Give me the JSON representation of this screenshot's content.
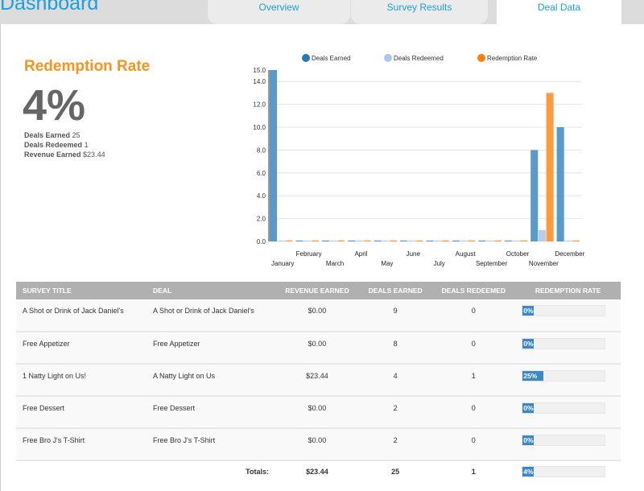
{
  "header": {
    "title": "Dashboard",
    "tabs": [
      {
        "label": "Overview"
      },
      {
        "label": "Survey Results"
      },
      {
        "label": "Deal Data",
        "active": true
      }
    ]
  },
  "summary": {
    "label": "Redemption Rate",
    "value": "4%",
    "deals_earned_label": "Deals Earned",
    "deals_earned": "25",
    "deals_redeemed_label": "Deals Redeemed",
    "deals_redeemed": "1",
    "revenue_label": "Revenue Earned",
    "revenue": "$23.44"
  },
  "colors": {
    "accent": "#1aa0dc",
    "orange": "#f7931e",
    "deals_earned": "#5a9ac9",
    "deals_redeemed": "#b9cde8",
    "redemption_rate": "#ff9a40"
  },
  "chart_data": {
    "type": "bar",
    "categories": [
      "January",
      "February",
      "March",
      "April",
      "May",
      "June",
      "July",
      "August",
      "September",
      "October",
      "November",
      "December"
    ],
    "series": [
      {
        "name": "Deals Earned",
        "values": [
          15,
          0,
          0,
          0,
          0,
          0,
          0,
          0,
          0,
          0,
          8,
          10
        ]
      },
      {
        "name": "Deals Redeemed",
        "values": [
          0,
          0,
          0,
          0,
          0,
          0,
          0,
          0,
          0,
          0,
          1,
          0
        ]
      },
      {
        "name": "Redemption Rate",
        "values": [
          0,
          0,
          0,
          0,
          0,
          0,
          0,
          0,
          0,
          0,
          13,
          0
        ]
      }
    ],
    "yticks": [
      "0.0",
      "2.0",
      "4.0",
      "6.0",
      "8.0",
      "10.0",
      "12.0",
      "14.0",
      "15.0"
    ],
    "ylim": [
      0,
      15
    ],
    "grid": true,
    "legend": "top"
  },
  "table": {
    "headers": [
      "SURVEY TITLE",
      "DEAL",
      "REVENUE EARNED",
      "DEALS EARNED",
      "DEALS REDEEMED",
      "REDEMPTION RATE"
    ],
    "rows": [
      {
        "survey": "A Shot or Drink of Jack Daniel's",
        "deal": "A Shot or Drink of Jack Daniel's",
        "revenue": "$0.00",
        "earned": "9",
        "redeemed": "0",
        "rate": "0%",
        "rate_value": 0
      },
      {
        "survey": "Free Appetizer",
        "deal": "Free Appetizer",
        "revenue": "$0.00",
        "earned": "8",
        "redeemed": "0",
        "rate": "0%",
        "rate_value": 0
      },
      {
        "survey": "1 Natty Light on Us!",
        "deal": "A Natty Light on Us",
        "revenue": "$23.44",
        "earned": "4",
        "redeemed": "1",
        "rate": "25%",
        "rate_value": 25
      },
      {
        "survey": "Free Dessert",
        "deal": "Free Dessert",
        "revenue": "$0.00",
        "earned": "2",
        "redeemed": "0",
        "rate": "0%",
        "rate_value": 0
      },
      {
        "survey": "Free Bro J's T-Shirt",
        "deal": "Free Bro J's T-Shirt",
        "revenue": "$0.00",
        "earned": "2",
        "redeemed": "0",
        "rate": "0%",
        "rate_value": 0
      }
    ],
    "totals": {
      "label": "Totals:",
      "revenue": "$23.44",
      "earned": "25",
      "redeemed": "1",
      "rate": "4%",
      "rate_value": 4
    }
  }
}
